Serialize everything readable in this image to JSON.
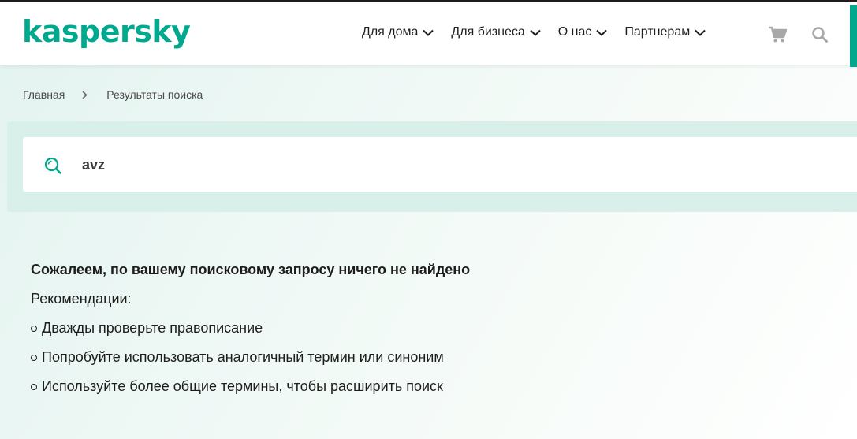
{
  "header": {
    "logo": "kaspersky",
    "nav": [
      {
        "label": "Для дома"
      },
      {
        "label": "Для бизнеса"
      },
      {
        "label": "О нас"
      },
      {
        "label": "Партнерам"
      }
    ],
    "icons": {
      "cart": "cart-icon",
      "search": "search-icon"
    },
    "accent_color": "#00a88e"
  },
  "breadcrumb": {
    "home": "Главная",
    "current": "Результаты поиска"
  },
  "search": {
    "value": "avz"
  },
  "results": {
    "title": "Сожалеем, по вашему поисковому запросу ничего не найдено",
    "recommendations_label": "Рекомендации:",
    "tips": [
      "Дважды проверьте правописание",
      "Попробуйте использовать аналогичный термин или синоним",
      "Используйте более общие термины, чтобы расширить поиск"
    ]
  }
}
